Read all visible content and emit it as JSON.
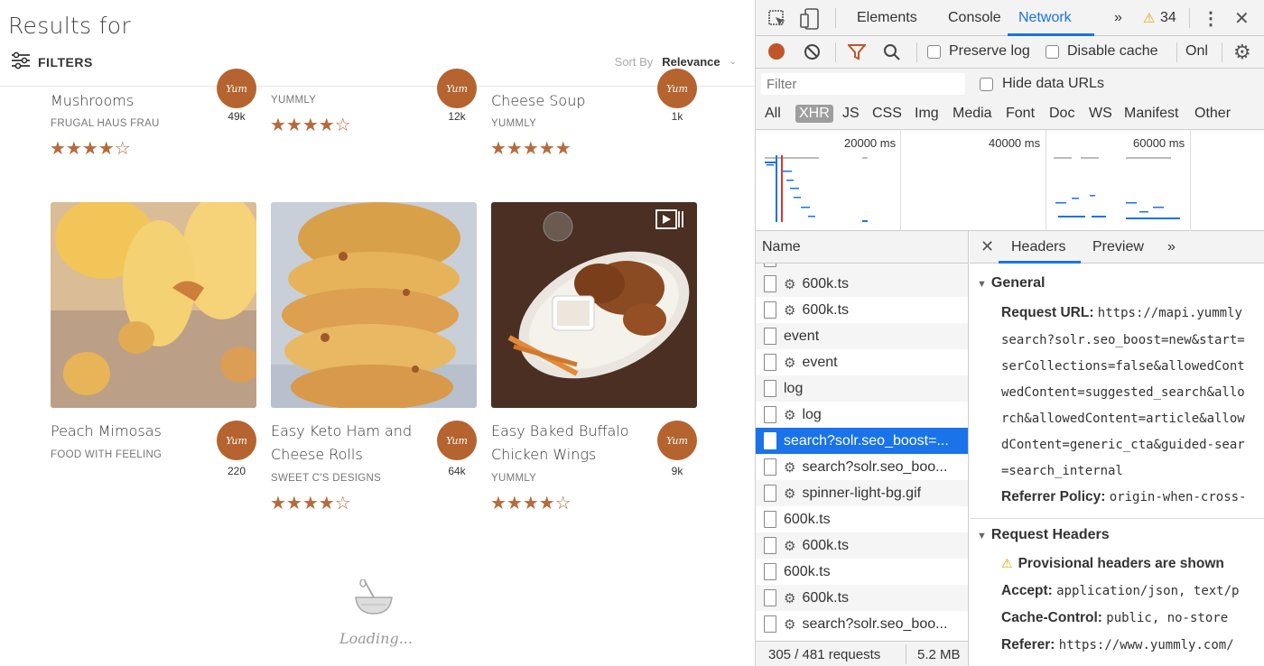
{
  "page": {
    "results_title": "Results for",
    "filters_label": "FILTERS",
    "sort_label": "Sort By",
    "sort_value": "Relevance",
    "loading_text": "Loading...",
    "top_row": [
      {
        "title": "Mushrooms",
        "source": "FRUGAL HAUS FRAU",
        "stars": "★★★★☆",
        "yum_count": "49k"
      },
      {
        "title": "",
        "source": "YUMMLY",
        "stars": "★★★★☆",
        "yum_count": "12k"
      },
      {
        "title": "Cheese Soup",
        "source": "YUMMLY",
        "stars": "★★★★★",
        "yum_count": "1k"
      }
    ],
    "cards": [
      {
        "title_line1": "Peach Mimosas",
        "title_line2": "",
        "source": "FOOD WITH FEELING",
        "stars": "",
        "yum_count": "220",
        "image": "peach-mimosas"
      },
      {
        "title_line1": "Easy Keto Ham and",
        "title_line2": "Cheese Rolls",
        "source": "SWEET C'S DESIGNS",
        "stars": "★★★★☆",
        "yum_count": "64k",
        "image": "keto-ham-rolls"
      },
      {
        "title_line1": "Easy Baked Buffalo",
        "title_line2": "Chicken Wings",
        "source": "YUMMLY",
        "stars": "★★★★☆",
        "yum_count": "9k",
        "image": "buffalo-wings"
      }
    ],
    "yum_badge": "Yum",
    "accent_color": "#b5632f"
  },
  "devtools": {
    "tabs": [
      "Elements",
      "Console",
      "Network"
    ],
    "active_tab": "Network",
    "more": "»",
    "warning_count": "34",
    "toolbar": {
      "preserve_log": "Preserve log",
      "disable_cache": "Disable cache",
      "online": "Onl"
    },
    "filter_placeholder": "Filter",
    "hide_data_urls": "Hide data URLs",
    "types": [
      "All",
      "XHR",
      "JS",
      "CSS",
      "Img",
      "Media",
      "Font",
      "Doc",
      "WS",
      "Manifest",
      "Other"
    ],
    "active_type": "XHR",
    "overview_labels": [
      "20000 ms",
      "40000 ms",
      "60000 ms"
    ],
    "list_header": "Name",
    "requests": [
      {
        "name": "600k.ts",
        "gear": true
      },
      {
        "name": "600k.ts",
        "gear": true
      },
      {
        "name": "event",
        "gear": false
      },
      {
        "name": "event",
        "gear": true
      },
      {
        "name": "log",
        "gear": false
      },
      {
        "name": "log",
        "gear": true
      },
      {
        "name": "search?solr.seo_boost=...",
        "gear": false,
        "selected": true
      },
      {
        "name": "search?solr.seo_boo...",
        "gear": true
      },
      {
        "name": "spinner-light-bg.gif",
        "gear": true
      },
      {
        "name": "600k.ts",
        "gear": false
      },
      {
        "name": "600k.ts",
        "gear": true
      },
      {
        "name": "600k.ts",
        "gear": false
      },
      {
        "name": "600k.ts",
        "gear": true
      },
      {
        "name": "search?solr.seo_boo...",
        "gear": true
      }
    ],
    "status_requests": "305 / 481 requests",
    "status_size": "5.2 MB",
    "detail_tabs": [
      "Headers",
      "Preview"
    ],
    "detail_active": "Headers",
    "general_title": "General",
    "request_url_key": "Request URL:",
    "request_url_lines": [
      "https://mapi.yummly",
      "search?solr.seo_boost=new&start=",
      "serCollections=false&allowedCont",
      "wedContent=suggested_search&allo",
      "rch&allowedContent=article&allow",
      "dContent=generic_cta&guided-sear",
      "=search_internal"
    ],
    "referrer_policy_key": "Referrer Policy:",
    "referrer_policy_val": "origin-when-cross-",
    "request_headers_title": "Request Headers",
    "provisional_warning": "Provisional headers are shown",
    "headers": [
      {
        "key": "Accept:",
        "value": "application/json, text/p"
      },
      {
        "key": "Cache-Control:",
        "value": "public, no-store"
      },
      {
        "key": "Referer:",
        "value": "https://www.yummly.com/"
      }
    ]
  }
}
